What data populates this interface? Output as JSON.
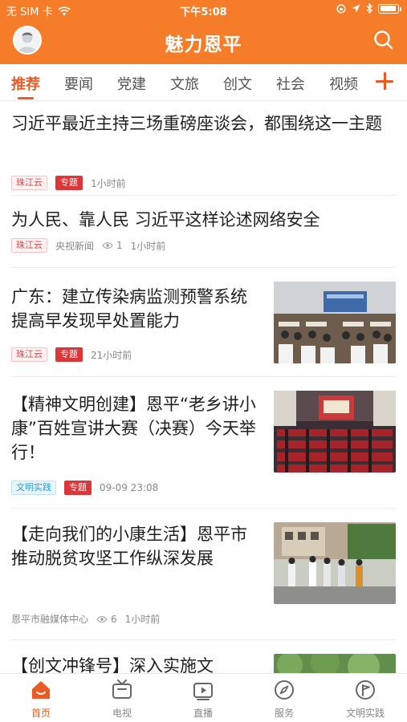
{
  "status_bar": {
    "carrier": "无 SIM 卡",
    "time": "下午5:08",
    "battery_level": 0.95
  },
  "header": {
    "title": "魅力恩平",
    "avatar_icon": "user-avatar",
    "search_icon": "search-icon"
  },
  "tabs": {
    "items": [
      {
        "label": "推荐",
        "active": true
      },
      {
        "label": "要闻"
      },
      {
        "label": "党建"
      },
      {
        "label": "文旅"
      },
      {
        "label": "创文"
      },
      {
        "label": "社会"
      },
      {
        "label": "视频"
      }
    ],
    "add_icon": "plus-icon"
  },
  "articles": [
    {
      "title": "习近平最近主持三场重磅座谈会，都围绕这一主题",
      "source": "珠江云",
      "tag": "专题",
      "time": "1小时前"
    },
    {
      "title": "为人民、靠人民 习近平这样论述网络安全",
      "source": "珠江云",
      "author": "央视新闻",
      "views": "1",
      "time": "1小时前"
    },
    {
      "title": "广东：建立传染病监测预警系统 提高早发现早处置能力",
      "source": "珠江云",
      "tag": "专题",
      "time": "21小时前"
    },
    {
      "title": "【精神文明创建】恩平“老乡讲小康”百姓宣讲大赛（决赛）今天举行！",
      "source": "文明实践",
      "tag": "专题",
      "time": "09-09 23:08"
    },
    {
      "title": "【走向我们的小康生活】恩平市推动脱贫攻坚工作纵深发展",
      "author": "恩平市融媒体中心",
      "views": "6",
      "time": "1小时前"
    },
    {
      "title": "【创文冲锋号】深入实施文"
    }
  ],
  "bottom_nav": {
    "items": [
      {
        "label": "首页",
        "icon": "home-icon",
        "active": true
      },
      {
        "label": "电视",
        "icon": "tv-icon"
      },
      {
        "label": "直播",
        "icon": "live-video-icon"
      },
      {
        "label": "服务",
        "icon": "compass-icon"
      },
      {
        "label": "文明实践",
        "icon": "flag-icon"
      }
    ]
  },
  "colors": {
    "brand_orange": "#f57c28",
    "accent_red": "#ea5a25",
    "tag_red": "#d9373a",
    "tag_blue": "#2b9ad3"
  }
}
